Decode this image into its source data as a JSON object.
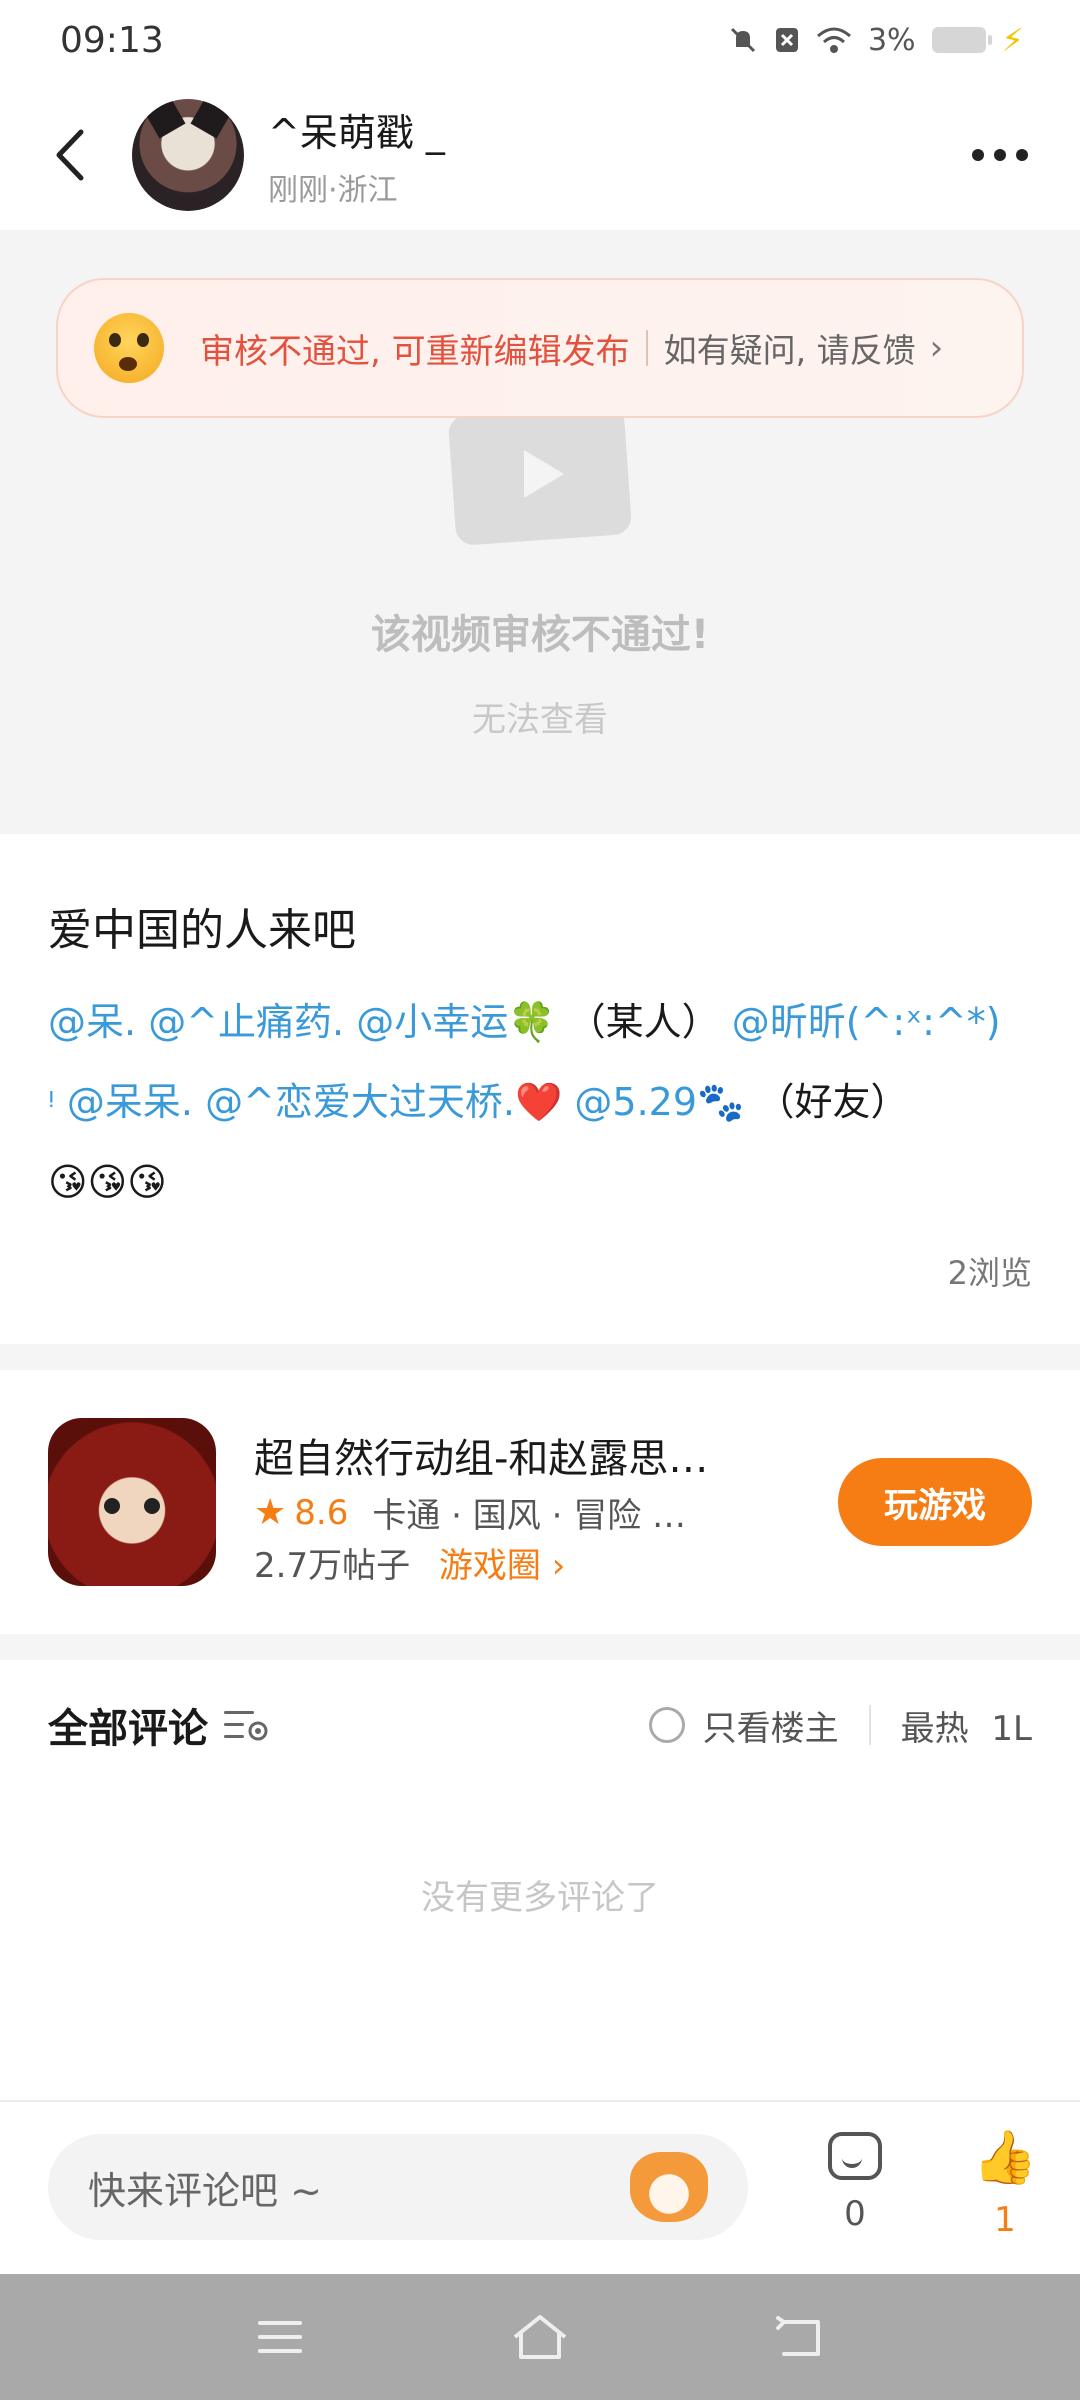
{
  "status_bar": {
    "time": "09:13",
    "battery_text": "3%",
    "icons": [
      "mute-icon",
      "notification-off-icon",
      "wifi-icon",
      "battery-icon",
      "charging-icon"
    ]
  },
  "header": {
    "user_name": "^呆萌戳 _",
    "meta": "刚刚·浙江"
  },
  "video": {
    "banner_error": "审核不通过, 可重新编辑发布",
    "banner_help": "如有疑问, 请反馈",
    "fail_title": "该视频审核不通过!",
    "fail_sub": "无法查看"
  },
  "post": {
    "title": "爱中国的人来吧",
    "mentions": {
      "m1": "@呆.",
      "m2": "@^止痛药.",
      "m3": "@小幸运🍀",
      "t1": "（某人）",
      "m4": "@昕昕(^:ˣ:^*)",
      "m4b": "ᵎ",
      "m5": "@呆呆.",
      "m6": "@^恋爱大过天桥.❤️",
      "m7": "@5.29🐾",
      "t2": "（好友）",
      "emojis": "😘😘😘"
    },
    "views": "2浏览"
  },
  "game": {
    "title": "超自然行动组-和赵露思…",
    "rating": "8.6",
    "tags": "卡通 · 国风 · 冒险 …",
    "posts": "2.7万帖子",
    "circle": "游戏圈 ›",
    "play_label": "玩游戏"
  },
  "comments": {
    "title": "全部评论",
    "only_op": "只看楼主",
    "sort": "最热",
    "sort_extra": "1L",
    "no_more": "没有更多评论了"
  },
  "bottom_bar": {
    "input_placeholder": "快来评论吧 ~",
    "comment_count": "0",
    "like_count": "1"
  },
  "colors": {
    "accent": "#f57d14",
    "mention": "#3a9ad9",
    "error": "#e2533f"
  }
}
